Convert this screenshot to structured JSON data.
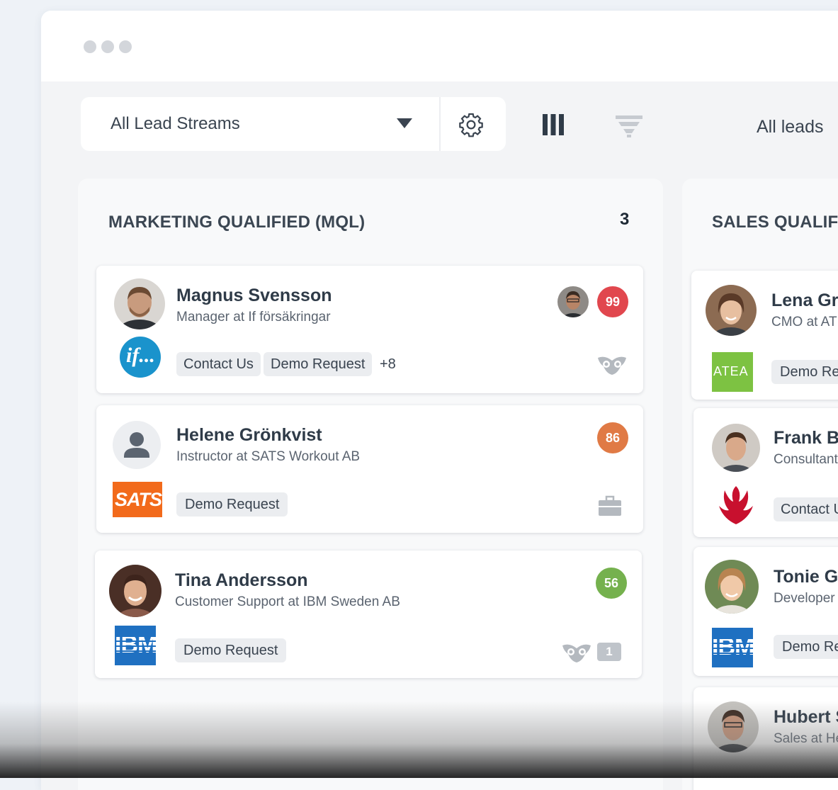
{
  "toolbar": {
    "stream_select": "All Lead Streams",
    "view_filter": "All leads"
  },
  "columns": [
    {
      "title": "MARKETING QUALIFIED (MQL)",
      "count": "3",
      "cards": [
        {
          "name": "Magnus Svensson",
          "role": "Manager at If försäkringar",
          "tags": [
            "Contact Us",
            "Demo Request"
          ],
          "more": "+8",
          "score": "99",
          "score_color": "#e1474e",
          "logo": "If logo",
          "source_icon": "owl-icon"
        },
        {
          "name": "Helene Grönkvist",
          "role": "Instructor at SATS Workout AB",
          "tags": [
            "Demo Request"
          ],
          "score": "86",
          "score_color": "#e07a45",
          "logo": "SATS",
          "source_icon": "briefcase-icon"
        },
        {
          "name": "Tina Andersson",
          "role": "Customer Support at IBM Sweden AB",
          "tags": [
            "Demo Request"
          ],
          "score": "56",
          "score_color": "#75b14e",
          "logo": "IBM",
          "source_icon": "owl-icon",
          "badge": "1"
        }
      ]
    },
    {
      "title": "SALES QUALIFI",
      "cards": [
        {
          "name": "Lena Grö",
          "role": "CMO at AT",
          "tag": "Demo Re",
          "logo": "ATEA"
        },
        {
          "name": "Frank Ba",
          "role": "Consultant",
          "tag": "Contact U",
          "logo": "phoenix-logo"
        },
        {
          "name": "Tonie Gr",
          "role": "Developer",
          "tag": "Demo Re",
          "logo": "IBM"
        },
        {
          "name": "Hubert S",
          "role": "Sales at He"
        }
      ]
    }
  ]
}
